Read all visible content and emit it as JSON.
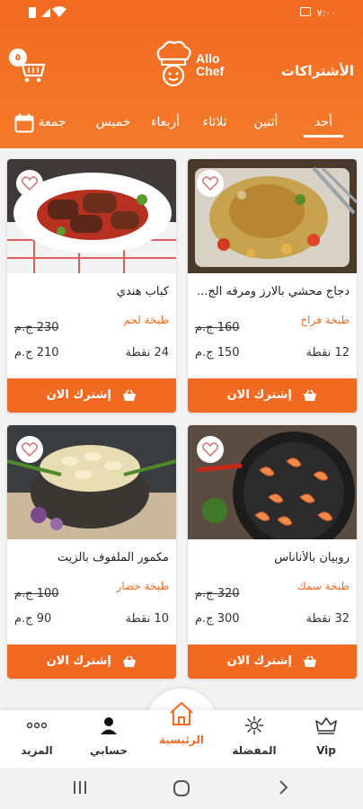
{
  "status": {
    "time": "٧:٠٠"
  },
  "header": {
    "cart_count": "٥",
    "logo_line1": "Allo",
    "logo_line2": "Chef",
    "subscriptions_link": "الأشتراكات"
  },
  "days": [
    {
      "label": "أحد",
      "active": true
    },
    {
      "label": "أثنين",
      "active": false
    },
    {
      "label": "ثلاثاء",
      "active": false
    },
    {
      "label": "أربعاء",
      "active": false
    },
    {
      "label": "خميس",
      "active": false
    },
    {
      "label": "جمعة",
      "active": false
    }
  ],
  "cards": [
    {
      "name": "دجاج محشي بالارز ومرقه الج...",
      "cuisine": "طبخة فراخ",
      "old_price": "160 ج.م",
      "new_price": "150 ج.م",
      "points": "12 نقطة",
      "button": "إشترك الان"
    },
    {
      "name": "كباب هندي",
      "cuisine": "طبخة لحم",
      "old_price": "230 ج.م",
      "new_price": "210 ج.م",
      "points": "24 نقطة",
      "button": "إشترك الان"
    },
    {
      "name": "روبيان بالأناناس",
      "cuisine": "طبخة سمك",
      "old_price": "320 ج.م",
      "new_price": "300 ج.م",
      "points": "32 نقطة",
      "button": "إشترك الان"
    },
    {
      "name": "مكمور الملفوف بالزيت",
      "cuisine": "طبخة خضار",
      "old_price": "100 ج.م",
      "new_price": "90 ج.م",
      "points": "10 نقطة",
      "button": "إشترك الان"
    }
  ],
  "nav": {
    "vip": "Vip",
    "favorites": "المفضلة",
    "home": "الرئيسية",
    "account": "حسابي",
    "more": "المزيد"
  },
  "colors": {
    "accent": "#f26a21"
  }
}
